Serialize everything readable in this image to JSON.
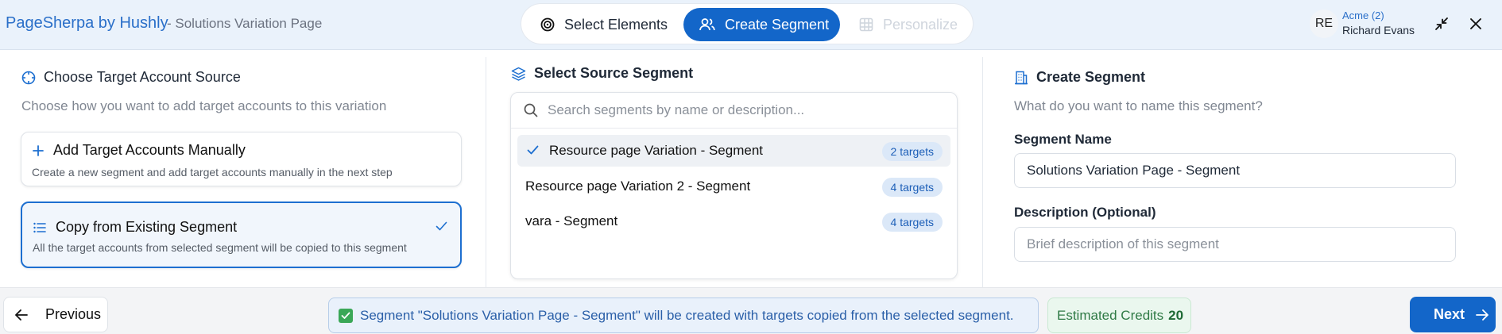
{
  "header": {
    "brand": "PageSherpa by Hushly",
    "page_subtitle": "- Solutions Variation Page",
    "steps": [
      {
        "label": "Select Elements",
        "icon": "target-icon",
        "state": "done"
      },
      {
        "label": "Create Segment",
        "icon": "users-icon",
        "state": "active"
      },
      {
        "label": "Personalize",
        "icon": "grid-icon",
        "state": "disabled"
      }
    ],
    "account": {
      "initials": "RE",
      "org": "Acme (2)",
      "user": "Richard Evans"
    },
    "icons": {
      "minimize": "minimize-icon",
      "close": "close-icon"
    }
  },
  "left": {
    "title": "Choose Target Account Source",
    "subtitle": "Choose how you want to add target accounts to this variation",
    "options": [
      {
        "title": "Add Target Accounts Manually",
        "desc": "Create a new segment and add target accounts manually in the next step",
        "icon": "plus-icon",
        "selected": false
      },
      {
        "title": "Copy from Existing Segment",
        "desc": "All the target accounts from selected segment will be copied to this segment",
        "icon": "list-icon",
        "selected": true
      }
    ]
  },
  "middle": {
    "title": "Select Source Segment",
    "search_placeholder": "Search segments by name or description...",
    "segments": [
      {
        "name": "Resource page Variation - Segment",
        "targets": "2 targets",
        "selected": true
      },
      {
        "name": "Resource page Variation 2 - Segment",
        "targets": "4 targets",
        "selected": false
      },
      {
        "name": "vara - Segment",
        "targets": "4 targets",
        "selected": false
      }
    ]
  },
  "right": {
    "title": "Create Segment",
    "subtitle": "What do you want to name this segment?",
    "name_label": "Segment Name",
    "name_value": "Solutions Variation Page - Segment",
    "desc_label": "Description (Optional)",
    "desc_placeholder": "Brief description of this segment"
  },
  "footer": {
    "previous_label": "Previous",
    "info_text": "Segment \"Solutions Variation Page - Segment\" will be created with targets copied from the selected segment.",
    "credits_label": "Estimated Credits",
    "credits_value": "20",
    "next_label": "Next"
  },
  "colors": {
    "accent": "#1366c9",
    "selected_border": "#1d6fd0",
    "badge_bg": "#dbe8f8",
    "credits_green": "#2f7a45"
  }
}
